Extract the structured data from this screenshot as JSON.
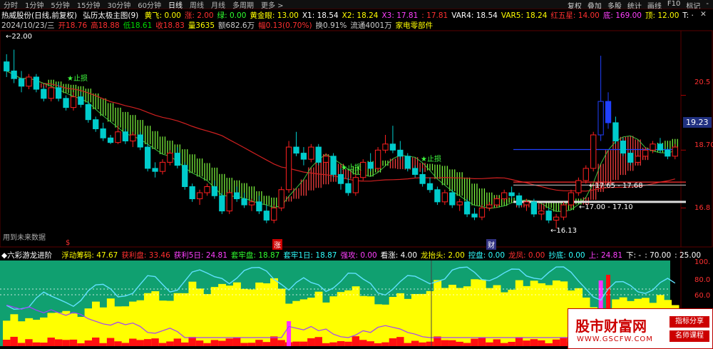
{
  "toolbar": {
    "tabs": [
      "分时",
      "1分钟",
      "5分钟",
      "15分钟",
      "30分钟",
      "60分钟",
      "日线",
      "周线",
      "月线",
      "多周期",
      "更多 >"
    ],
    "active": "日线",
    "right_buttons": [
      "复权",
      "叠加",
      "多股",
      "统计",
      "画线",
      "F10",
      "标记",
      "-"
    ]
  },
  "indicator_line": {
    "stock": "热威股份(日线,前复权)",
    "indicator": "弘历太极主图(9)",
    "items": [
      {
        "label": "黄飞: 0.00",
        "color": "#ffff00"
      },
      {
        "label": "涨: 2.00",
        "color": "#ff3030"
      },
      {
        "label": "绿: 0.00",
        "color": "#30ff30"
      },
      {
        "label": "黄金眼: 13.00",
        "color": "#ffff00"
      },
      {
        "label": "X1: 18.54",
        "color": "#ffffff"
      },
      {
        "label": "X2: 18.24",
        "color": "#ffff00"
      },
      {
        "label": "X3: 17.81",
        "color": "#ff40ff"
      },
      {
        "label": ": 17.81",
        "color": "#ff3030"
      },
      {
        "label": "VAR4: 18.54",
        "color": "#ffffff"
      },
      {
        "label": "VAR5: 18.24",
        "color": "#ffff00"
      },
      {
        "label": "红五星: 14.00",
        "color": "#ff3030"
      },
      {
        "label": "底: 169.00",
        "color": "#ff40ff"
      },
      {
        "label": "顶: 12.00",
        "color": "#ffff00"
      },
      {
        "label": "T: ·",
        "color": "#ffffff"
      }
    ]
  },
  "quote_line": [
    {
      "label": "2024/10/23/三",
      "color": "#cccccc"
    },
    {
      "label": "开18.76",
      "color": "#ff3030"
    },
    {
      "label": "高18.88",
      "color": "#ff3030"
    },
    {
      "label": "低18.61",
      "color": "#00dd00"
    },
    {
      "label": "收18.83",
      "color": "#ff3030"
    },
    {
      "label": "量3635",
      "color": "#ffff00"
    },
    {
      "label": "额682.6万",
      "color": "#cccccc"
    },
    {
      "label": "幅0.13(0.70%)",
      "color": "#ff3030"
    },
    {
      "label": "换0.91%",
      "color": "#cccccc"
    },
    {
      "label": "流通4001万",
      "color": "#cccccc"
    },
    {
      "label": "家电零部件",
      "color": "#ffff00"
    }
  ],
  "main_annotations": {
    "high_label": "22.00",
    "low_label": "16.13",
    "stop_loss_1": "止损",
    "stop_loss_2": "止损",
    "stop_loss_3": "止损",
    "range_1": "17.65 - 17.68",
    "range_2": "17.00 - 17.10",
    "future_label": "用到未来数据",
    "event_s": "$",
    "event_zhang": "涨",
    "event_cai": "财"
  },
  "main_price_axis": {
    "ticks": [
      "20.5",
      "18.70",
      "16.8"
    ],
    "current": "19.23",
    "range": [
      15.8,
      22.6
    ]
  },
  "sub_indicator": {
    "name": "六彩游龙进阶",
    "items": [
      {
        "label": "浮动筹码: 47.67",
        "color": "#ffff00"
      },
      {
        "label": "获利盘: 33.46",
        "color": "#ff3030"
      },
      {
        "label": "获利5日: 24.81",
        "color": "#ff40ff"
      },
      {
        "label": "套牢盘: 18.87",
        "color": "#30ff30"
      },
      {
        "label": "套牢1日: 18.87",
        "color": "#30ffff"
      },
      {
        "label": "强攻: 0.00",
        "color": "#ff40ff"
      },
      {
        "label": "看涨: 4.00",
        "color": "#ffffff"
      },
      {
        "label": "龙抬头: 2.00",
        "color": "#ffff00"
      },
      {
        "label": "控盘: 0.00",
        "color": "#30ffff"
      },
      {
        "label": "龙凤: 0.00",
        "color": "#ff3030"
      },
      {
        "label": "抄底: 0.00",
        "color": "#30ffff"
      },
      {
        "label": "上: 24.81",
        "color": "#ff40ff"
      },
      {
        "label": "下: -",
        "color": "#ffffff"
      },
      {
        "label": ": 70.00",
        "color": "#ffffff"
      },
      {
        "label": ": 25.00",
        "color": "#ffffff"
      }
    ],
    "axis_ticks": [
      "100.",
      "80.0",
      "60.0"
    ]
  },
  "watermark": {
    "title": "股市财富网",
    "url": "WWW.GSCFW.COM",
    "tag1": "指标分享",
    "tag2": "名师课程"
  },
  "colors": {
    "up": "#ff2020",
    "down": "#00cccc",
    "band_up": "#ff4040",
    "band_down": "#80ff40",
    "ma_red": "#d02020",
    "ma_green": "#40c040",
    "yellow": "#ffff00",
    "blue": "#2040ff"
  },
  "chart_data": {
    "type": "candlestick",
    "title": "热威股份(日线,前复权)",
    "last_date": "2024/10/23",
    "ohlc": [
      [
        21.6,
        21.85,
        21.1,
        21.3
      ],
      [
        21.3,
        22.0,
        20.9,
        21.05
      ],
      [
        21.05,
        21.3,
        20.6,
        20.8
      ],
      [
        20.8,
        21.2,
        20.7,
        21.1
      ],
      [
        21.1,
        21.2,
        20.6,
        20.7
      ],
      [
        20.7,
        20.8,
        20.3,
        20.4
      ],
      [
        20.4,
        20.8,
        20.3,
        20.75
      ],
      [
        20.75,
        20.9,
        20.3,
        20.4
      ],
      [
        20.4,
        20.5,
        20.0,
        20.1
      ],
      [
        20.1,
        20.6,
        20.0,
        20.45
      ],
      [
        20.45,
        20.6,
        20.1,
        20.2
      ],
      [
        20.2,
        20.3,
        19.6,
        19.7
      ],
      [
        19.7,
        19.8,
        19.3,
        19.4
      ],
      [
        19.4,
        19.6,
        19.0,
        19.1
      ],
      [
        19.1,
        19.2,
        18.9,
        18.95
      ],
      [
        18.95,
        19.5,
        18.9,
        19.3
      ],
      [
        19.3,
        19.4,
        18.9,
        19.0
      ],
      [
        19.0,
        19.3,
        18.8,
        19.2
      ],
      [
        19.2,
        19.3,
        18.7,
        18.8
      ],
      [
        18.8,
        18.9,
        18.0,
        18.1
      ],
      [
        18.1,
        18.3,
        17.8,
        18.0
      ],
      [
        18.0,
        18.4,
        17.9,
        18.3
      ],
      [
        18.3,
        18.7,
        18.2,
        18.6
      ],
      [
        18.6,
        18.8,
        18.1,
        18.2
      ],
      [
        18.2,
        18.3,
        17.4,
        17.5
      ],
      [
        17.5,
        17.6,
        17.0,
        17.1
      ],
      [
        17.1,
        17.4,
        16.9,
        17.3
      ],
      [
        17.3,
        17.6,
        17.2,
        17.5
      ],
      [
        17.5,
        17.7,
        17.1,
        17.2
      ],
      [
        17.2,
        17.3,
        16.6,
        16.7
      ],
      [
        16.7,
        17.4,
        16.6,
        17.3
      ],
      [
        17.3,
        17.5,
        17.0,
        17.1
      ],
      [
        17.1,
        17.3,
        16.8,
        16.9
      ],
      [
        16.9,
        17.1,
        16.7,
        17.0
      ],
      [
        17.0,
        17.2,
        16.6,
        16.7
      ],
      [
        16.7,
        16.9,
        16.3,
        16.4
      ],
      [
        16.4,
        16.9,
        16.3,
        16.8
      ],
      [
        16.8,
        17.5,
        16.7,
        17.4
      ],
      [
        17.4,
        19.0,
        17.3,
        18.8
      ],
      [
        18.8,
        19.3,
        18.5,
        18.6
      ],
      [
        18.6,
        18.8,
        18.2,
        18.4
      ],
      [
        18.4,
        18.9,
        18.3,
        18.8
      ],
      [
        18.8,
        18.9,
        18.2,
        18.3
      ],
      [
        18.3,
        18.6,
        18.1,
        18.5
      ],
      [
        18.5,
        18.6,
        17.8,
        17.9
      ],
      [
        17.9,
        18.1,
        17.4,
        17.6
      ],
      [
        17.6,
        17.8,
        17.2,
        17.3
      ],
      [
        17.3,
        17.9,
        17.2,
        17.8
      ],
      [
        17.8,
        18.4,
        17.7,
        18.3
      ],
      [
        18.3,
        18.6,
        18.0,
        18.1
      ],
      [
        18.1,
        18.8,
        18.0,
        18.7
      ],
      [
        18.7,
        19.2,
        18.6,
        18.9
      ],
      [
        18.9,
        19.5,
        18.6,
        18.7
      ],
      [
        18.7,
        19.0,
        18.4,
        18.5
      ],
      [
        18.5,
        18.6,
        18.0,
        18.1
      ],
      [
        18.1,
        18.2,
        17.8,
        17.9
      ],
      [
        17.9,
        18.1,
        17.5,
        17.6
      ],
      [
        17.6,
        17.8,
        17.3,
        17.4
      ],
      [
        17.4,
        17.5,
        16.9,
        17.0
      ],
      [
        17.0,
        17.4,
        16.9,
        17.3
      ],
      [
        17.3,
        17.4,
        16.8,
        16.9
      ],
      [
        16.9,
        17.1,
        16.7,
        17.0
      ],
      [
        17.0,
        17.1,
        16.5,
        16.6
      ],
      [
        16.6,
        16.8,
        16.4,
        16.5
      ],
      [
        16.5,
        16.9,
        16.4,
        16.8
      ],
      [
        16.8,
        17.0,
        16.7,
        16.9
      ],
      [
        16.9,
        17.2,
        16.8,
        17.1
      ],
      [
        17.1,
        17.4,
        17.0,
        17.3
      ],
      [
        17.3,
        17.5,
        17.1,
        17.2
      ],
      [
        17.2,
        17.3,
        16.8,
        16.9
      ],
      [
        16.9,
        17.1,
        16.7,
        17.0
      ],
      [
        17.0,
        17.1,
        16.5,
        16.6
      ],
      [
        16.6,
        16.8,
        16.4,
        16.7
      ],
      [
        16.7,
        16.8,
        16.3,
        16.4
      ],
      [
        16.4,
        16.6,
        16.13,
        16.5
      ],
      [
        16.5,
        17.0,
        16.4,
        16.9
      ],
      [
        16.9,
        17.4,
        16.8,
        17.3
      ],
      [
        17.3,
        17.8,
        17.2,
        17.7
      ],
      [
        17.7,
        18.2,
        17.6,
        18.1
      ],
      [
        18.1,
        19.3,
        18.0,
        19.2
      ],
      [
        19.2,
        21.8,
        19.0,
        20.3
      ],
      [
        20.3,
        20.6,
        19.4,
        19.6
      ],
      [
        19.6,
        19.8,
        18.9,
        19.0
      ],
      [
        19.0,
        19.1,
        18.5,
        18.6
      ],
      [
        18.6,
        18.7,
        18.2,
        18.3
      ],
      [
        18.3,
        18.6,
        18.2,
        18.5
      ],
      [
        18.5,
        18.8,
        18.4,
        18.7
      ],
      [
        18.7,
        19.0,
        18.6,
        18.9
      ],
      [
        18.9,
        19.1,
        18.6,
        18.7
      ],
      [
        18.7,
        18.8,
        18.4,
        18.5
      ],
      [
        18.5,
        18.9,
        18.4,
        18.8
      ]
    ]
  }
}
